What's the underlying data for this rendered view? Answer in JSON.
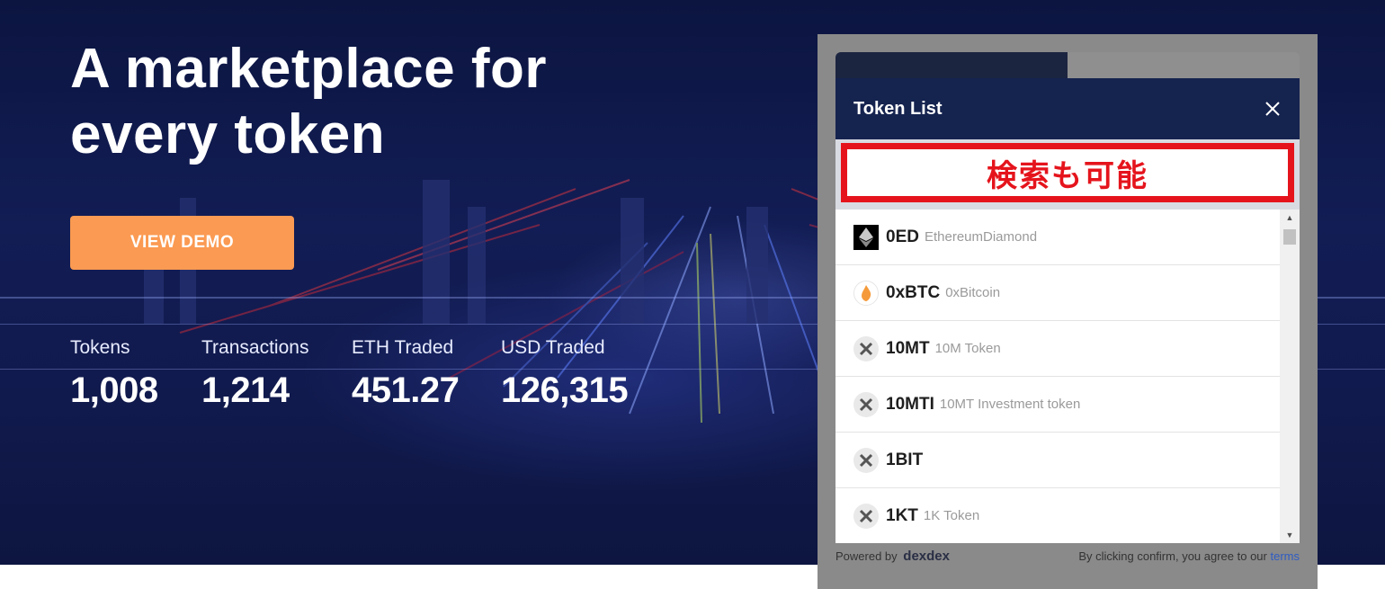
{
  "hero": {
    "headline_line1": "A marketplace for",
    "headline_line2": "every token",
    "cta_label": "VIEW DEMO",
    "stats": [
      {
        "label": "Tokens",
        "value": "1,008"
      },
      {
        "label": "Transactions",
        "value": "1,214"
      },
      {
        "label": "ETH Traded",
        "value": "451.27"
      },
      {
        "label": "USD Traded",
        "value": "126,315"
      }
    ]
  },
  "widget": {
    "title": "Token List",
    "close_icon": "close-icon",
    "search_placeholder": "",
    "search_annotation": "検索も可能",
    "tokens": [
      {
        "symbol": "0ED",
        "name": "EthereumDiamond",
        "icon": "ethereum-icon"
      },
      {
        "symbol": "0xBTC",
        "name": "0xBitcoin",
        "icon": "bitcoin-flame-icon"
      },
      {
        "symbol": "10MT",
        "name": "10M Token",
        "icon": "x-token-icon"
      },
      {
        "symbol": "10MTI",
        "name": "10MT Investment token",
        "icon": "x-token-icon"
      },
      {
        "symbol": "1BIT",
        "name": "",
        "icon": "x-token-icon"
      },
      {
        "symbol": "1KT",
        "name": "1K Token",
        "icon": "x-token-icon"
      }
    ],
    "footer": {
      "powered_by": "Powered by",
      "brand": "dexdex",
      "terms_text": "By clicking confirm, you agree to our",
      "terms_link": "terms"
    }
  },
  "colors": {
    "cta": "#fb9a52",
    "header": "#15234f",
    "annotation": "#e5141c"
  }
}
